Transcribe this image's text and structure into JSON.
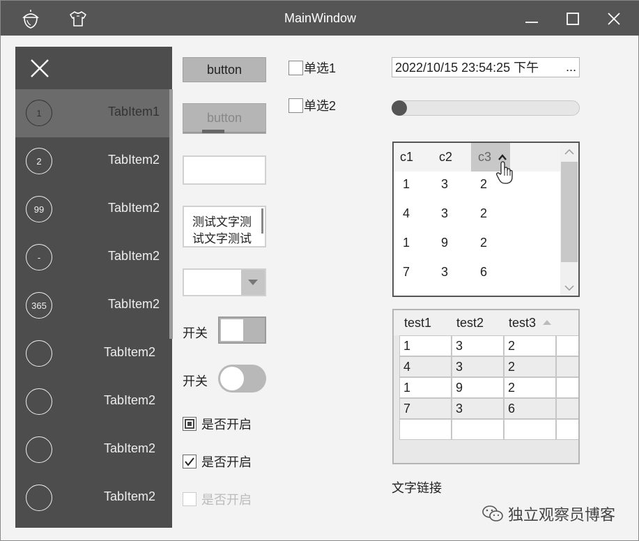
{
  "window": {
    "title": "MainWindow"
  },
  "sidebar": {
    "items": [
      {
        "badge": "1",
        "label": "TabItem1",
        "active": true
      },
      {
        "badge": "2",
        "label": "TabItem2"
      },
      {
        "badge": "99",
        "label": "TabItem2"
      },
      {
        "badge": "-",
        "label": "TabItem2"
      },
      {
        "badge": "365",
        "label": "TabItem2"
      },
      {
        "badge": "",
        "label": "TabItem2"
      },
      {
        "badge": "",
        "label": "TabItem2"
      },
      {
        "badge": "",
        "label": "TabItem2"
      },
      {
        "badge": "",
        "label": "TabItem2"
      }
    ]
  },
  "controls": {
    "button1_label": "button",
    "button2_label": "button",
    "textarea_text": "测试文字测试文字测试",
    "switch1_label": "开关",
    "switch2_label": "开关",
    "check1_label": "是否开启",
    "check2_label": "是否开启",
    "check3_label": "是否开启",
    "radio1_label": "单选1",
    "radio2_label": "单选2",
    "date_value": "2022/10/15 23:54:25 下午",
    "date_more": "...",
    "slider_value": 0
  },
  "listview": {
    "headers": [
      "c1",
      "c2",
      "c3"
    ],
    "rows": [
      [
        "1",
        "3",
        "2"
      ],
      [
        "4",
        "3",
        "2"
      ],
      [
        "1",
        "9",
        "2"
      ],
      [
        "7",
        "3",
        "6"
      ]
    ]
  },
  "datagrid": {
    "headers": [
      "test1",
      "test2",
      "test3"
    ],
    "rows": [
      [
        "1",
        "3",
        "2"
      ],
      [
        "4",
        "3",
        "2"
      ],
      [
        "1",
        "9",
        "2"
      ],
      [
        "7",
        "3",
        "6"
      ]
    ]
  },
  "link_label": "文字链接",
  "watermark_text": "独立观察员博客",
  "colors": {
    "titlebar": "#555555",
    "sidebar": "#4d4d4d",
    "sidebar_active": "#6b6b6b"
  }
}
